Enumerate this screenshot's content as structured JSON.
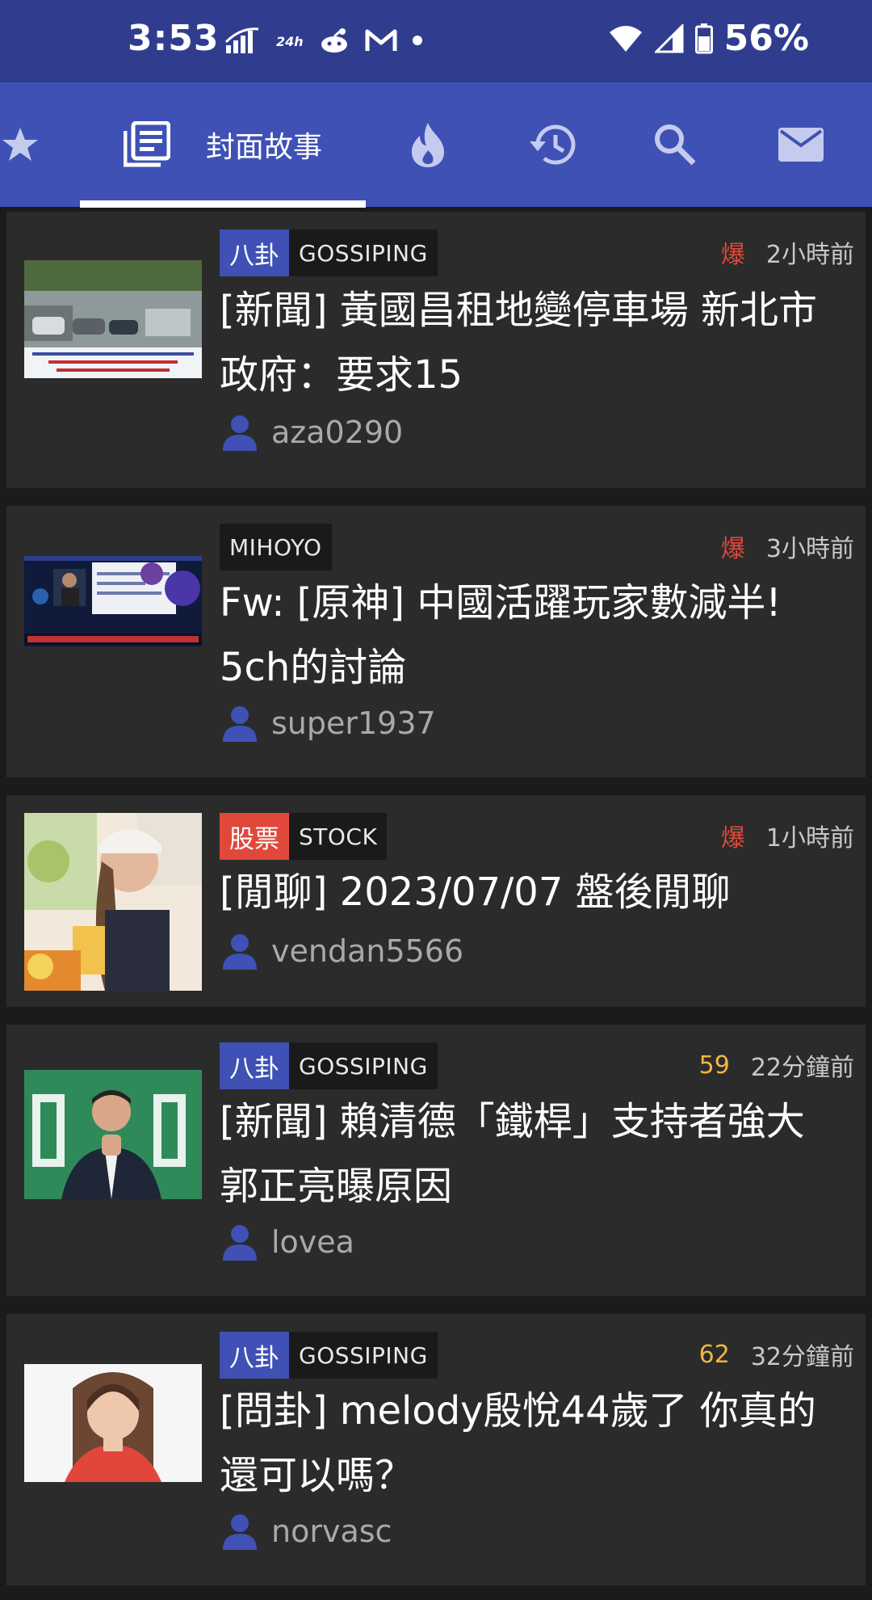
{
  "status_bar": {
    "time": "3:53",
    "battery": "56%",
    "icons": [
      "signal-bars-icon",
      "24h-icon",
      "reddit-icon",
      "gmail-icon",
      "dot-icon",
      "wifi-icon",
      "cell-signal-icon",
      "battery-icon"
    ]
  },
  "tabs": {
    "active_label": "封面故事",
    "items": [
      "star-icon",
      "newspaper-icon",
      "fire-icon",
      "history-icon",
      "search-icon",
      "mail-icon"
    ]
  },
  "posts": [
    {
      "category": "八卦",
      "category_color": "#3f51b5",
      "board": "GOSSIPING",
      "badge": "爆",
      "time": "2小時前",
      "title": "[新聞] 黃國昌租地變停車場 新北市政府：要求15",
      "author": "aza0290"
    },
    {
      "category": "",
      "board": "MIHOYO",
      "badge": "爆",
      "time": "3小時前",
      "title": "Fw: [原神] 中國活躍玩家數減半! 5ch的討論",
      "author": "super1937"
    },
    {
      "category": "股票",
      "category_color": "#e0483b",
      "board": "STOCK",
      "badge": "爆",
      "time": "1小時前",
      "title": "[閒聊] 2023/07/07 盤後閒聊",
      "author": "vendan5566"
    },
    {
      "category": "八卦",
      "category_color": "#3f51b5",
      "board": "GOSSIPING",
      "badge": "59",
      "time": "22分鐘前",
      "title": "[新聞] 賴清德「鐵桿」支持者強大　郭正亮曝原因",
      "author": "lovea"
    },
    {
      "category": "八卦",
      "category_color": "#3f51b5",
      "board": "GOSSIPING",
      "badge": "62",
      "time": "32分鐘前",
      "title": "[問卦] melody殷悅44歲了 你真的還可以嗎？",
      "author": "norvasc"
    }
  ]
}
